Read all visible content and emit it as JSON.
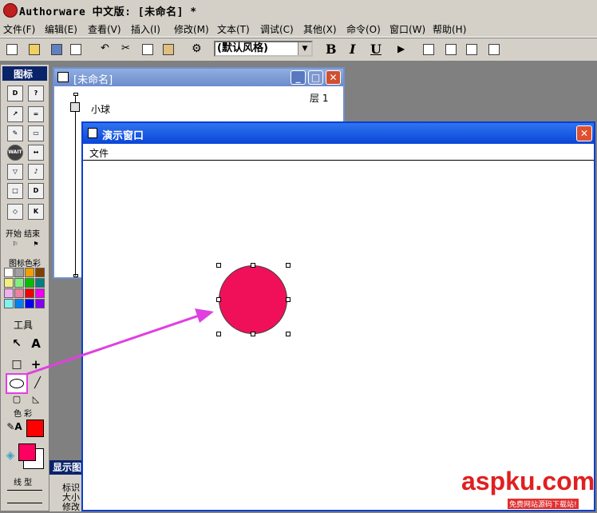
{
  "window": {
    "title": "Authorware 中文版: [未命名] *"
  },
  "menu": [
    "文件(F)",
    "编辑(E)",
    "查看(V)",
    "插入(I)",
    "修改(M)",
    "文本(T)",
    "调试(C)",
    "其他(X)",
    "命令(O)",
    "窗口(W)",
    "帮助(H)"
  ],
  "toolbar": {
    "style_value": "(默认风格)",
    "bold": "B",
    "italic": "I",
    "underline": "U"
  },
  "palette": {
    "title": "图标",
    "start_end": "开始 结束",
    "icon_color": "图标色彩",
    "tools_title": "工具",
    "text_tool": "A",
    "colors_title": "色 彩",
    "line_title": "线 型",
    "wait_label": "WAIT",
    "swatch_colors": [
      "#ffffff",
      "#a0a0a0",
      "#f0a000",
      "#804000",
      "#f0f080",
      "#80f080",
      "#00c000",
      "#008080",
      "#f0b0f0",
      "#f080a0",
      "#f00000",
      "#f000f0",
      "#80f0f0",
      "#0080f0",
      "#0000f0",
      "#8000f0"
    ],
    "fill_color": "#ff0060",
    "line_color": "#ff0000"
  },
  "flow_window": {
    "title": "[未命名]",
    "level": "层 1",
    "node_label": "小球"
  },
  "present_window": {
    "title": "演示窗口",
    "menu_file": "文件",
    "circle_color": "#f0105a"
  },
  "props_panel": {
    "title": "显示图",
    "rows": [
      "标识",
      "大小",
      "修改"
    ]
  },
  "annotation_color": "#e040e0",
  "watermark": {
    "main": "aspku.com",
    "sub": "免费网站源码下载站!"
  }
}
